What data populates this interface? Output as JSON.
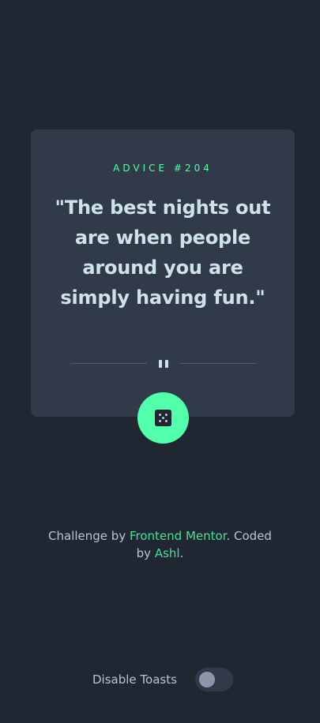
{
  "card": {
    "label": "ADVICE #204",
    "quote": "\"The best nights out are when people around you are simply having fun.\""
  },
  "dice_button": {
    "icon": "dice-icon"
  },
  "footer": {
    "prefix": "Challenge by ",
    "challenge_link": "Frontend Mentor",
    "middle": ". Coded by ",
    "author_link": "Ashl",
    "suffix": "."
  },
  "toast": {
    "label": "Disable Toasts",
    "enabled": false
  },
  "colors": {
    "background": "#202632",
    "card": "#313a48",
    "accent": "#53ffaa",
    "text": "#cee3e9",
    "divider": "#4f5d74"
  }
}
